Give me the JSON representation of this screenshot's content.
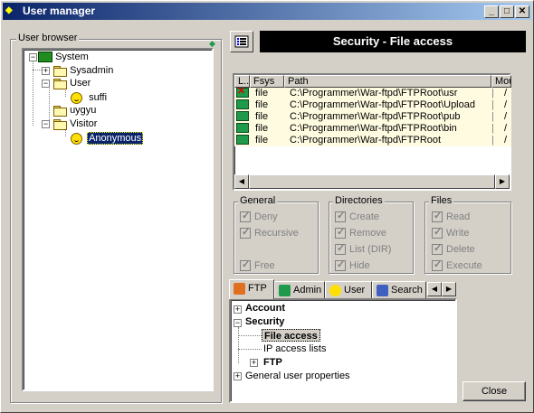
{
  "window": {
    "title": "User manager"
  },
  "user_browser": {
    "label": "User browser",
    "tree": [
      {
        "label": "System"
      },
      {
        "label": "Sysadmin"
      },
      {
        "label": "User"
      },
      {
        "label": "suffi"
      },
      {
        "label": "uygyu"
      },
      {
        "label": "Visitor"
      },
      {
        "label": "Anonymous"
      }
    ]
  },
  "header": {
    "title": "Security - File access"
  },
  "file_list": {
    "columns": [
      "L..",
      "Fsys",
      "Path",
      "Mou"
    ],
    "rows": [
      {
        "fsys": "file",
        "path": "C:\\Programmer\\War-ftpd\\FTPRoot\\usr",
        "mount": "/",
        "icon": "denied"
      },
      {
        "fsys": "file",
        "path": "C:\\Programmer\\War-ftpd\\FTPRoot\\Upload",
        "mount": "/",
        "icon": "allowed"
      },
      {
        "fsys": "file",
        "path": "C:\\Programmer\\War-ftpd\\FTPRoot\\pub",
        "mount": "/",
        "icon": "allowed"
      },
      {
        "fsys": "file",
        "path": "C:\\Programmer\\War-ftpd\\FTPRoot\\bin",
        "mount": "/",
        "icon": "allowed"
      },
      {
        "fsys": "file",
        "path": "C:\\Programmer\\War-ftpd\\FTPRoot",
        "mount": "/",
        "icon": "allowed"
      }
    ]
  },
  "general": {
    "label": "General",
    "deny": "Deny",
    "recursive": "Recursive",
    "free": "Free"
  },
  "directories": {
    "label": "Directories",
    "create": "Create",
    "remove": "Remove",
    "list": "List (DIR)",
    "hide": "Hide"
  },
  "files": {
    "label": "Files",
    "read": "Read",
    "write": "Write",
    "delete": "Delete",
    "execute": "Execute"
  },
  "tabs": [
    {
      "label": "FTP"
    },
    {
      "label": "Admin"
    },
    {
      "label": "User"
    },
    {
      "label": "Search"
    }
  ],
  "settings_tree": [
    {
      "label": "Account"
    },
    {
      "label": "Security"
    },
    {
      "label": "File access"
    },
    {
      "label": "IP access lists"
    },
    {
      "label": "FTP"
    },
    {
      "label": "General user properties"
    }
  ],
  "close_button": {
    "label": "Close"
  },
  "colors": {
    "title_start": "#0a246a",
    "title_end": "#a6caf0",
    "row_bg": "#fffbe0",
    "selection": "#0a246a"
  }
}
